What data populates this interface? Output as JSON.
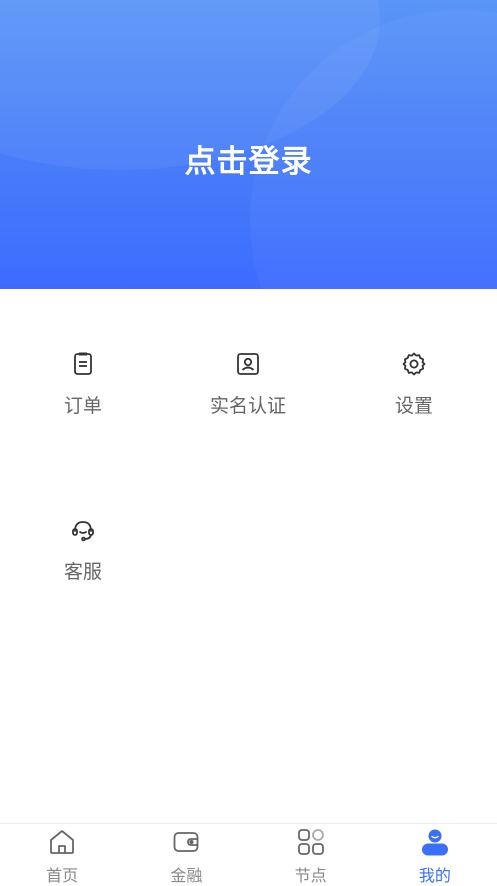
{
  "header": {
    "login_label": "点击登录"
  },
  "menu": {
    "items": [
      {
        "label": "订单",
        "icon": "order-icon"
      },
      {
        "label": "实名认证",
        "icon": "id-card-icon"
      },
      {
        "label": "设置",
        "icon": "gear-icon"
      },
      {
        "label": "客服",
        "icon": "headset-icon"
      }
    ]
  },
  "tabbar": {
    "tabs": [
      {
        "label": "首页",
        "icon": "home-icon",
        "active": false
      },
      {
        "label": "金融",
        "icon": "wallet-icon",
        "active": false
      },
      {
        "label": "节点",
        "icon": "apps-icon",
        "active": false
      },
      {
        "label": "我的",
        "icon": "user-icon",
        "active": true
      }
    ]
  },
  "colors": {
    "header_gradient_top": "#5a95f7",
    "header_gradient_bottom": "#3d6cff",
    "accent": "#3a6ff7",
    "tab_inactive": "#888888",
    "menu_label": "#666666"
  }
}
